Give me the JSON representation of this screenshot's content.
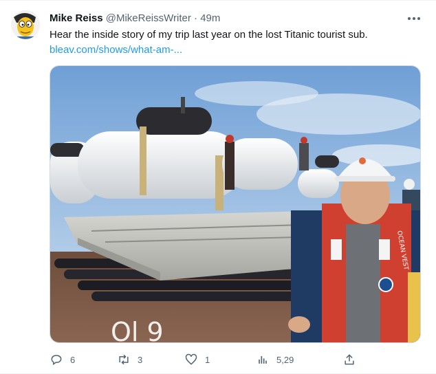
{
  "tweet": {
    "author": {
      "display_name": "Mike Reiss",
      "handle": "@MikeReissWriter",
      "separator": "·",
      "time": "49m"
    },
    "text": "Hear the inside story of my trip last year on the lost Titanic tourist sub.",
    "link_text": "bleav.com/shows/what-am-..."
  },
  "image": {
    "vest_label": "OCEAN VEST",
    "overlay_text": "Ol   9"
  },
  "actions": {
    "reply_count": "6",
    "retweet_count": "3",
    "like_count": "1",
    "views_count": "5,29"
  },
  "icons": {
    "more": "more-horizontal-icon",
    "reply": "reply-icon",
    "retweet": "retweet-icon",
    "like": "heart-icon",
    "views": "views-icon",
    "share": "share-icon"
  },
  "colors": {
    "link": "#1d9bf0",
    "secondary_text": "#536471",
    "primary_text": "#0f1419"
  }
}
